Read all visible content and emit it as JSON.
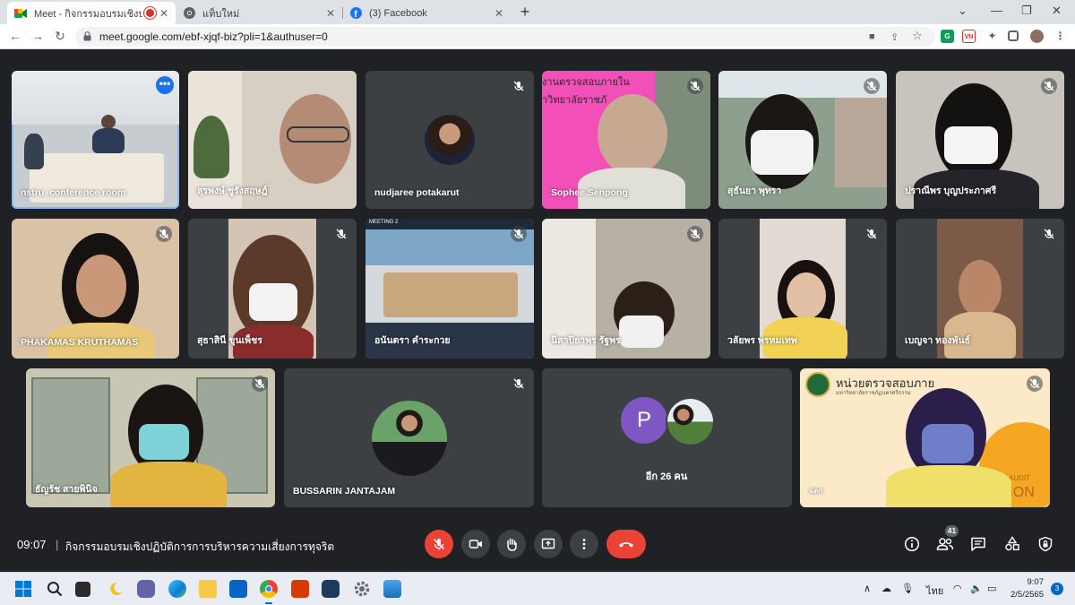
{
  "browser": {
    "tabs": [
      {
        "title": "Meet - กิจกรรมอบรมเชิงปฏิบัติก",
        "active": true
      },
      {
        "title": "แท็บใหม่",
        "active": false
      },
      {
        "title": "(3) Facebook",
        "active": false
      }
    ],
    "url": "meet.google.com/ebf-xjqf-biz?pli=1&authuser=0"
  },
  "meeting": {
    "time": "09:07",
    "title": "กิจกรรมอบรมเชิงปฏิบัติการการบริหารความเสี่ยงการทุจริต",
    "participant_count": "41",
    "others_label": "อีก 26 คน",
    "others_letter": "P",
    "tiles": [
      {
        "name": "nstru_conference room"
      },
      {
        "name": "สุรพงษ์ ชูรังสฤษฎ์"
      },
      {
        "name": "nudjaree potakarut"
      },
      {
        "name": "Sophee Senpong"
      },
      {
        "name": "สุธันยา พุทรา"
      },
      {
        "name": "ปราณีพร บุญประภาศรี"
      },
      {
        "name": "PHAKAMAS KRUTHAMAS"
      },
      {
        "name": "สุธาสินี ขุนเพ็ชร"
      },
      {
        "name": "อนันตรา คำระกวย"
      },
      {
        "name": "นิสาปิยาพร รัฐพร"
      },
      {
        "name": "วลัยพร พรหมเทพ"
      },
      {
        "name": "เบญจา ทองพันธ์"
      },
      {
        "name": "ธัญรัช สายพินิจ"
      },
      {
        "name": "BUSSARIN JANTAJAM"
      },
      {
        "name": "อีก 26 คน"
      },
      {
        "name": "ฉตก"
      }
    ],
    "tile_texts": {
      "sophee_banner_1": "งานตรวจสอบภายใน",
      "sophee_banner_2": "าวิทยาลัยราชภั",
      "meeting_screen_label": "MEETING 2",
      "audit_banner": "หน่วยตรวจสอบภาย",
      "audit_sub": "มหาวิทยาลัยราชภัฏนครศรีธรรม",
      "audit_footer_1": "TERNAL AUDIT",
      "audit_footer_2": "CTION"
    }
  },
  "taskbar": {
    "clock_time": "9:07",
    "clock_date": "2/5/2565",
    "lang": "ไทย",
    "notifications": "3"
  },
  "colors": {
    "meet_bg": "#202124",
    "tile_bg": "#3c4043",
    "end_call": "#ea4335",
    "speaking_outline": "#8ab4f8"
  }
}
